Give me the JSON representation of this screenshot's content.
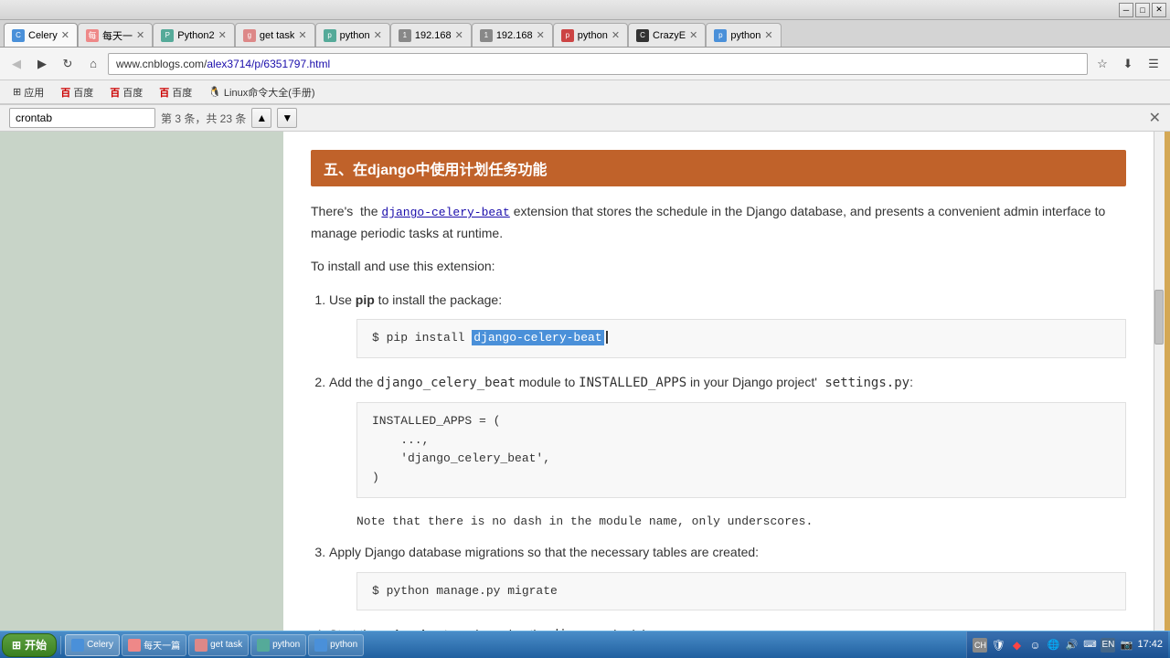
{
  "titlebar": {
    "buttons": [
      "─",
      "□",
      "✕"
    ]
  },
  "tabs": [
    {
      "id": "t1",
      "favicon_color": "#4a90d9",
      "favicon_text": "C",
      "label": "Celery",
      "active": true
    },
    {
      "id": "t2",
      "favicon_color": "#e88",
      "favicon_text": "每",
      "label": "每天一",
      "active": false
    },
    {
      "id": "t3",
      "favicon_color": "#5a9",
      "favicon_text": "P",
      "label": "Python2",
      "active": false
    },
    {
      "id": "t4",
      "favicon_color": "#d88",
      "favicon_text": "g",
      "label": "get task",
      "active": false
    },
    {
      "id": "t5",
      "favicon_color": "#5a9",
      "favicon_text": "p",
      "label": "python",
      "active": false
    },
    {
      "id": "t6",
      "favicon_color": "#888",
      "favicon_text": "1",
      "label": "192.168",
      "active": false
    },
    {
      "id": "t7",
      "favicon_color": "#888",
      "favicon_text": "1",
      "label": "192.168",
      "active": false
    },
    {
      "id": "t8",
      "favicon_color": "#c44",
      "favicon_text": "p",
      "label": "python",
      "active": false
    },
    {
      "id": "t9",
      "favicon_color": "#333",
      "favicon_text": "C",
      "label": "CrazyE",
      "active": false
    },
    {
      "id": "t10",
      "favicon_color": "#4a90d9",
      "favicon_text": "p",
      "label": "python",
      "active": false
    }
  ],
  "address_bar": {
    "url": "www.cnblogs.com/alex3714/p/6351797.html"
  },
  "bookmarks": [
    {
      "label": "应用"
    },
    {
      "label": "百度"
    },
    {
      "label": "百度"
    },
    {
      "label": "百度"
    },
    {
      "label": "Linux命令大全(手册)"
    }
  ],
  "find_bar": {
    "query": "crontab",
    "count_text": "第 3 条，共 23 条",
    "placeholder": "crontab"
  },
  "section": {
    "title": "五、在django中使用计划任务功能"
  },
  "intro_text": "There's  the django-celery-beat extension that stores the schedule in the Django database, and presents a convenient admin interface to manage periodic tasks at runtime.",
  "install_text": "To install and use this extension:",
  "list_items": [
    {
      "id": 1,
      "text_before": "Use ",
      "bold": "pip",
      "text_after": " to install the package:",
      "code_block": {
        "prompt": "$ pip install",
        "highlighted": "django-celery-beat",
        "has_cursor": true
      }
    },
    {
      "id": 2,
      "text_before": "Add the ",
      "code": "django_celery_beat",
      "text_after": " module to ",
      "code2": "INSTALLED_APPS",
      "text_after2": " in your Django project'",
      "code3": "settings.py",
      "text_after3": ":",
      "code_block": {
        "lines": [
          "INSTALLED_APPS = (",
          "    ...,",
          "    'django_celery_beat',",
          ")"
        ]
      },
      "note": "Note that there is no dash in the module name, only underscores."
    },
    {
      "id": 3,
      "text_before": "Apply Django database migrations so that the necessary tables are created:",
      "code_block": {
        "lines": [
          "$ python manage.py migrate"
        ]
      }
    },
    {
      "id": 4,
      "text_before": "Start the ",
      "bold": "celery beat",
      "text_after": " service using the ",
      "code": "django",
      "text_after2": " scheduler:"
    }
  ],
  "taskbar": {
    "start_label": "开始",
    "buttons": [
      {
        "label": "Celery",
        "active": true,
        "color": "#4a90d9"
      },
      {
        "label": "每天一篇",
        "active": false,
        "color": "#e88"
      },
      {
        "label": "get task",
        "active": false,
        "color": "#d88"
      },
      {
        "label": "python",
        "active": false,
        "color": "#5a9"
      },
      {
        "label": "python",
        "active": false,
        "color": "#4a90d9"
      }
    ],
    "tray_icons": [
      "CH",
      "S",
      "♦",
      "☻",
      "🔊",
      "⌨",
      "EN"
    ],
    "time": "17:42"
  }
}
